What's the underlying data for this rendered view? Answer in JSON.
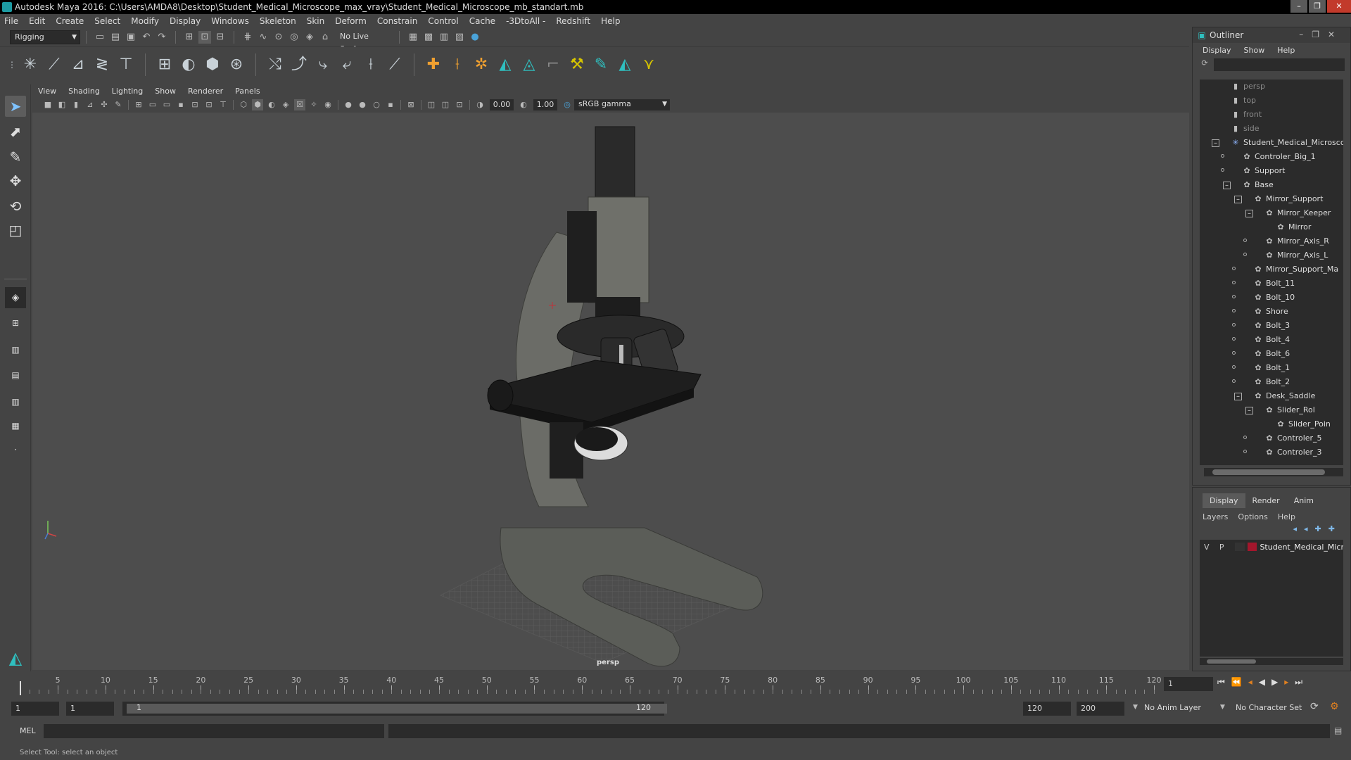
{
  "window": {
    "title": "Autodesk Maya 2016: C:\\Users\\AMDA8\\Desktop\\Student_Medical_Microscope_max_vray\\Student_Medical_Microscope_mb_standart.mb"
  },
  "menubar": [
    "File",
    "Edit",
    "Create",
    "Select",
    "Modify",
    "Display",
    "Windows",
    "Skeleton",
    "Skin",
    "Deform",
    "Constrain",
    "Control",
    "Cache",
    "-3DtoAll -",
    "Redshift",
    "Help"
  ],
  "statusline": {
    "mode": "Rigging",
    "live_surface": "No Live Surface"
  },
  "panel": {
    "menus": [
      "View",
      "Shading",
      "Lighting",
      "Show",
      "Renderer",
      "Panels"
    ],
    "exposure": "0.00",
    "gamma": "1.00",
    "color_space": "sRGB gamma",
    "camera_label": "persp"
  },
  "outliner": {
    "title": "Outliner",
    "menus": [
      "Display",
      "Show",
      "Help"
    ],
    "items": [
      {
        "label": "persp",
        "kind": "camera"
      },
      {
        "label": "top",
        "kind": "camera"
      },
      {
        "label": "front",
        "kind": "camera"
      },
      {
        "label": "side",
        "kind": "camera"
      },
      {
        "label": "Student_Medical_Microsco",
        "kind": "root"
      },
      {
        "label": "Controler_Big_1",
        "kind": "transform"
      },
      {
        "label": "Support",
        "kind": "transform"
      },
      {
        "label": "Base",
        "kind": "transform"
      },
      {
        "label": "Mirror_Support",
        "kind": "transform"
      },
      {
        "label": "Mirror_Keeper",
        "kind": "transform"
      },
      {
        "label": "Mirror",
        "kind": "transform"
      },
      {
        "label": "Mirror_Axis_R",
        "kind": "transform"
      },
      {
        "label": "Mirror_Axis_L",
        "kind": "transform"
      },
      {
        "label": "Mirror_Support_Ma",
        "kind": "transform"
      },
      {
        "label": "Bolt_11",
        "kind": "transform"
      },
      {
        "label": "Bolt_10",
        "kind": "transform"
      },
      {
        "label": "Shore",
        "kind": "transform"
      },
      {
        "label": "Bolt_3",
        "kind": "transform"
      },
      {
        "label": "Bolt_4",
        "kind": "transform"
      },
      {
        "label": "Bolt_6",
        "kind": "transform"
      },
      {
        "label": "Bolt_1",
        "kind": "transform"
      },
      {
        "label": "Bolt_2",
        "kind": "transform"
      },
      {
        "label": "Desk_Saddle",
        "kind": "transform"
      },
      {
        "label": "Slider_Rol",
        "kind": "transform"
      },
      {
        "label": "Slider_Poin",
        "kind": "transform"
      },
      {
        "label": "Controler_5",
        "kind": "transform"
      },
      {
        "label": "Controler_3",
        "kind": "transform"
      }
    ]
  },
  "layers": {
    "tabs": [
      "Display",
      "Render",
      "Anim"
    ],
    "menus": [
      "Layers",
      "Options",
      "Help"
    ],
    "row": {
      "v": "V",
      "p": "P",
      "name": "Student_Medical_Micr",
      "color": "#a3162c"
    }
  },
  "timeline": {
    "ticks": [
      "1",
      "5",
      "10",
      "15",
      "20",
      "25",
      "30",
      "35",
      "40",
      "45",
      "50",
      "55",
      "60",
      "65",
      "70",
      "75",
      "80",
      "85",
      "90",
      "95",
      "100",
      "105",
      "110",
      "115",
      "120"
    ],
    "current_frame": "1"
  },
  "range": {
    "start": "1",
    "playback_start": "1",
    "slider_start": "1",
    "slider_end": "120",
    "playback_end": "120",
    "end": "200",
    "anim_layer": "No Anim Layer",
    "character_set": "No Character Set"
  },
  "command": {
    "label": "MEL"
  },
  "helpline": {
    "text": "Select Tool: select an object"
  }
}
